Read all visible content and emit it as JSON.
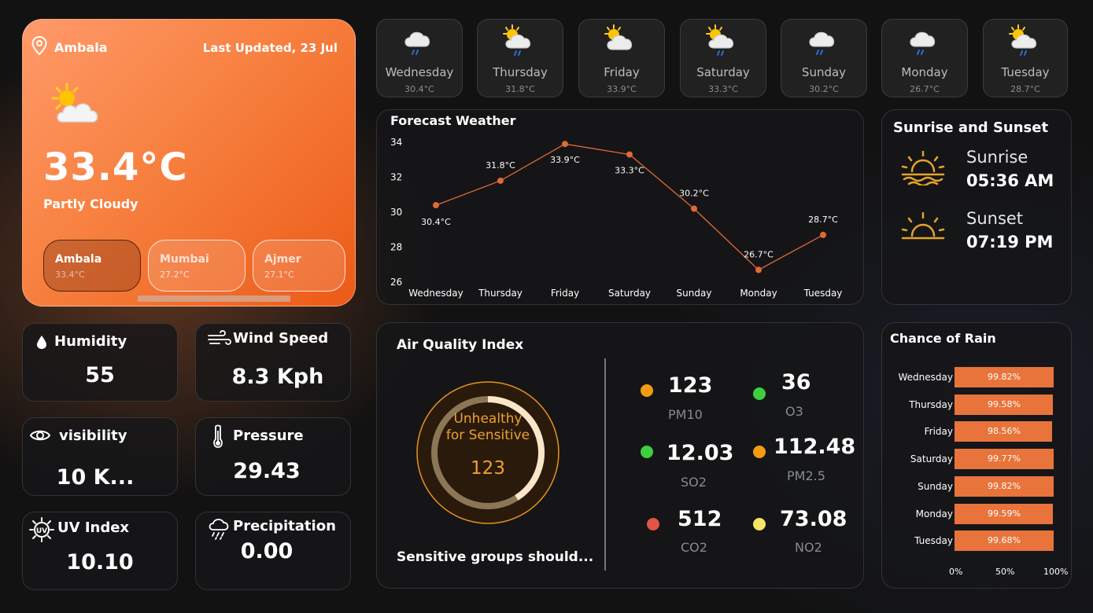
{
  "main": {
    "city": "Ambala",
    "last_updated": "Last Updated, 23 Jul",
    "temp": "33.4°C",
    "condition": "Partly Cloudy",
    "icon": "partly-cloudy-icon",
    "cities": [
      {
        "name": "Ambala",
        "temp": "33.4°C"
      },
      {
        "name": "Mumbai",
        "temp": "27.2°C"
      },
      {
        "name": "Ajmer",
        "temp": "27.1°C"
      }
    ]
  },
  "stats": {
    "humidity": {
      "label": "Humidity",
      "value": "55",
      "icon": "droplet-icon"
    },
    "wind": {
      "label": "Wind Speed",
      "value": "8.3 Kph",
      "icon": "wind-icon"
    },
    "visibility": {
      "label": "visibility",
      "value": "10 K...",
      "icon": "eye-icon"
    },
    "pressure": {
      "label": "Pressure",
      "value": "29.43",
      "icon": "thermometer-icon"
    },
    "uv": {
      "label": "UV Index",
      "value": "10.10",
      "icon": "uv-icon"
    },
    "precip": {
      "label": "Precipitation",
      "value": "0.00",
      "icon": "rain-cloud-icon"
    }
  },
  "days": [
    {
      "name": "Wednesday",
      "temp": "30.4°C",
      "icon": "rain-cloud-icon"
    },
    {
      "name": "Thursday",
      "temp": "31.8°C",
      "icon": "sun-rain-cloud-icon"
    },
    {
      "name": "Friday",
      "temp": "33.9°C",
      "icon": "partly-cloudy-icon"
    },
    {
      "name": "Saturday",
      "temp": "33.3°C",
      "icon": "sun-rain-cloud-icon"
    },
    {
      "name": "Sunday",
      "temp": "30.2°C",
      "icon": "rain-cloud-icon"
    },
    {
      "name": "Monday",
      "temp": "26.7°C",
      "icon": "rain-cloud-icon"
    },
    {
      "name": "Tuesday",
      "temp": "28.7°C",
      "icon": "sun-rain-cloud-icon"
    }
  ],
  "forecast_title": "Forecast Weather",
  "sun": {
    "title": "Sunrise and Sunset",
    "sunrise_label": "Sunrise",
    "sunrise_time": "05:36 AM",
    "sunset_label": "Sunset",
    "sunset_time": "07:19 PM"
  },
  "aqi": {
    "title": "Air Quality Index",
    "status_line1": "Unhealthy",
    "status_line2": "for Sensitive",
    "value": "123",
    "gauge_fraction": 0.41,
    "message": "Sensitive groups should...",
    "pollutants": [
      {
        "value": "123",
        "label": "PM10",
        "color": "#f39c12"
      },
      {
        "value": "36",
        "label": "O3",
        "color": "#3ecf3e"
      },
      {
        "value": "12.03",
        "label": "SO2",
        "color": "#3ecf3e"
      },
      {
        "value": "112.48",
        "label": "PM2.5",
        "color": "#f39c12"
      },
      {
        "value": "512",
        "label": "CO2",
        "color": "#e05545"
      },
      {
        "value": "73.08",
        "label": "NO2",
        "color": "#f5e663"
      }
    ]
  },
  "rain": {
    "title": "Chance of Rain",
    "axis_ticks": [
      "0%",
      "50%",
      "100%"
    ]
  },
  "colors": {
    "accent": "#ec6a2c",
    "bar": "#e8743b",
    "line": "#e06a35"
  },
  "chart_data": [
    {
      "type": "line",
      "title": "Forecast Weather",
      "categories": [
        "Wednesday",
        "Thursday",
        "Friday",
        "Saturday",
        "Sunday",
        "Monday",
        "Tuesday"
      ],
      "values": [
        30.4,
        31.8,
        33.9,
        33.3,
        30.2,
        26.7,
        28.7
      ],
      "data_labels": [
        "30.4°C",
        "31.8°C",
        "33.9°C",
        "33.3°C",
        "30.2°C",
        "26.7°C",
        "28.7°C"
      ],
      "yticks": [
        "26",
        "28",
        "30",
        "32",
        "34"
      ],
      "ylim": [
        26,
        34
      ],
      "grid": false
    },
    {
      "type": "bar",
      "orientation": "horizontal",
      "title": "Chance of Rain",
      "categories": [
        "Wednesday",
        "Thursday",
        "Friday",
        "Saturday",
        "Sunday",
        "Monday",
        "Tuesday"
      ],
      "values": [
        99.82,
        99.58,
        98.56,
        99.77,
        99.82,
        99.59,
        99.68
      ],
      "data_labels": [
        "99.82%",
        "99.58%",
        "98.56%",
        "99.77%",
        "99.82%",
        "99.59%",
        "99.68%"
      ],
      "xticks": [
        "0%",
        "50%",
        "100%"
      ],
      "xlim": [
        0,
        100
      ]
    }
  ]
}
